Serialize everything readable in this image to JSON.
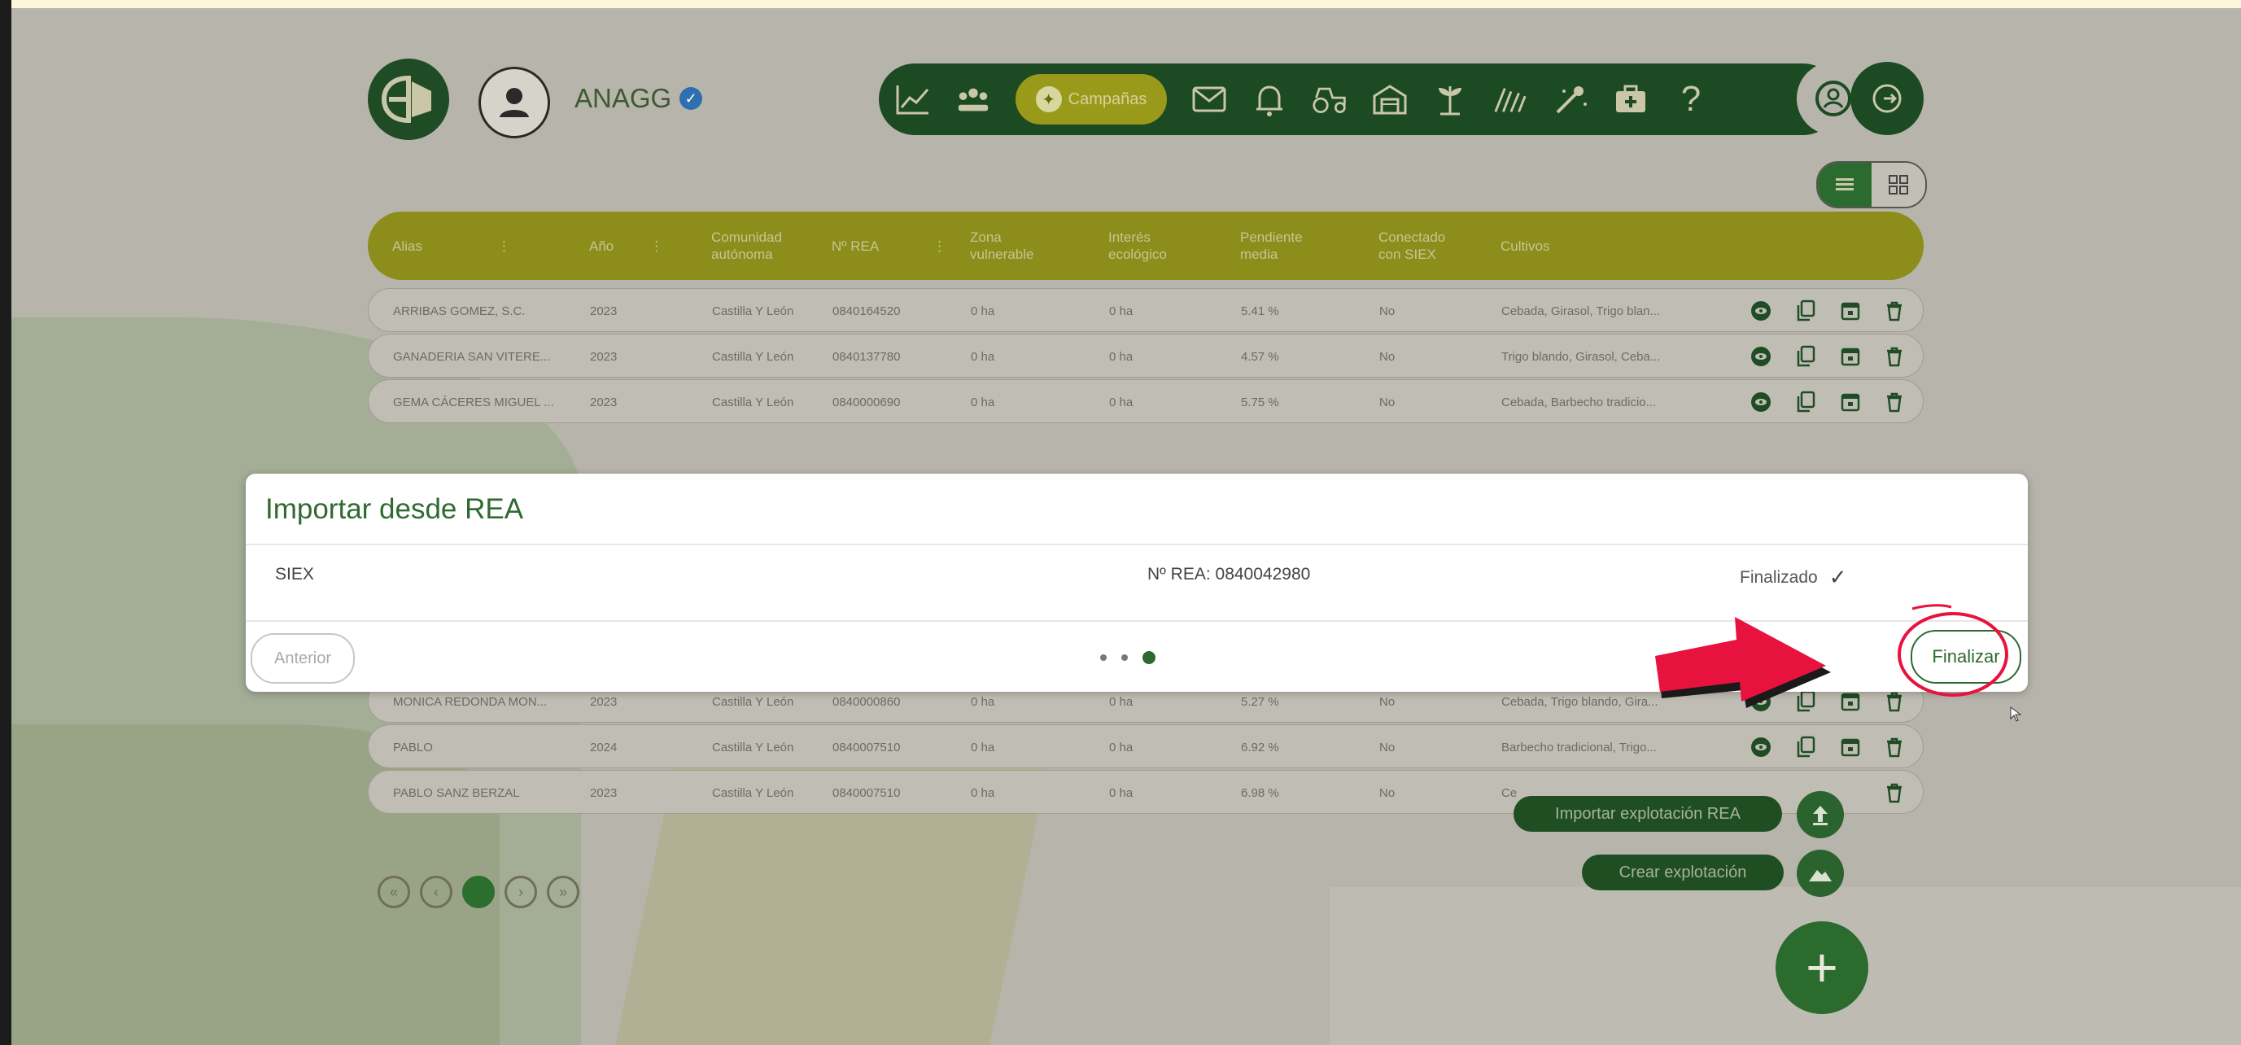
{
  "header": {
    "username": "ANAGG",
    "nav_active_label": "Campañas",
    "nav_icons": [
      "chart-line-icon",
      "people-icon",
      "campaign-icon",
      "mail-icon",
      "bell-icon",
      "tractor-icon",
      "warehouse-icon",
      "plant-icon",
      "field-icon",
      "sprayer-icon",
      "medkit-icon",
      "help-icon"
    ],
    "help_glyph": "?"
  },
  "table": {
    "columns": [
      "Alias",
      "Año",
      "Comunidad autónoma",
      "Nº REA",
      "Zona vulnerable",
      "Interés ecológico",
      "Pendiente media",
      "Conectado con SIEX",
      "Cultivos"
    ],
    "rows": [
      {
        "alias": "ARRIBAS GOMEZ, S.C.",
        "year": "2023",
        "community": "Castilla Y León",
        "rea": "0840164520",
        "zone": "0 ha",
        "eco": "0 ha",
        "slope": "5.41 %",
        "siex": "No",
        "crops": "Cebada, Girasol, Trigo blan..."
      },
      {
        "alias": "GANADERIA SAN VITERE...",
        "year": "2023",
        "community": "Castilla Y León",
        "rea": "0840137780",
        "zone": "0 ha",
        "eco": "0 ha",
        "slope": "4.57 %",
        "siex": "No",
        "crops": "Trigo blando, Girasol, Ceba..."
      },
      {
        "alias": "GEMA CÁCERES MIGUEL ...",
        "year": "2023",
        "community": "Castilla Y León",
        "rea": "0840000690",
        "zone": "0 ha",
        "eco": "0 ha",
        "slope": "5.75 %",
        "siex": "No",
        "crops": "Cebada, Barbecho tradicio..."
      },
      {
        "alias": "MONICA REDONDA MON...",
        "year": "2023",
        "community": "Castilla Y León",
        "rea": "0840000860",
        "zone": "0 ha",
        "eco": "0 ha",
        "slope": "5.27 %",
        "siex": "No",
        "crops": "Cebada, Trigo blando, Gira..."
      },
      {
        "alias": "PABLO",
        "year": "2024",
        "community": "Castilla Y León",
        "rea": "0840007510",
        "zone": "0 ha",
        "eco": "0 ha",
        "slope": "6.92 %",
        "siex": "No",
        "crops": "Barbecho tradicional, Trigo..."
      },
      {
        "alias": "PABLO SANZ BERZAL",
        "year": "2023",
        "community": "Castilla Y León",
        "rea": "0840007510",
        "zone": "0 ha",
        "eco": "0 ha",
        "slope": "6.98 %",
        "siex": "No",
        "crops": "Ce"
      }
    ]
  },
  "pagination": {
    "current": "1",
    "first": "«",
    "prev": "‹",
    "next": "›",
    "last": "»"
  },
  "modal": {
    "title": "Importar desde REA",
    "source": "SIEX",
    "rea_text": "Nº REA: 0840042980",
    "status": "Finalizado",
    "status_mark": "✓",
    "prev_label": "Anterior",
    "finish_label": "Finalizar",
    "steps_total": 3,
    "step_current": 3
  },
  "fab": {
    "import_label": "Importar explotación REA",
    "create_label": "Crear explotación",
    "main_glyph": "+"
  },
  "colors": {
    "dark_green": "#1c4a22",
    "olive": "#8d8d1b",
    "accent_red": "#e8123f"
  }
}
